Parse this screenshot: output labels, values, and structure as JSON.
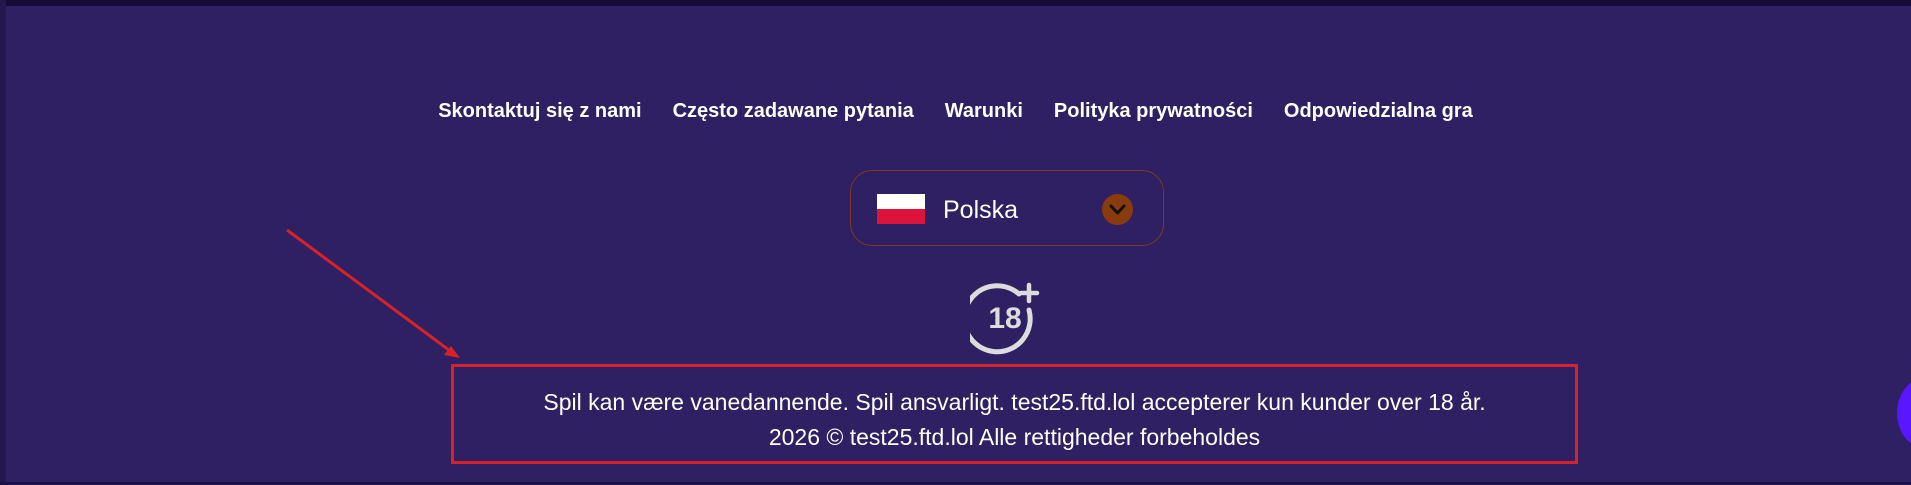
{
  "footer": {
    "nav_links": [
      {
        "label": "Skontaktuj się z nami"
      },
      {
        "label": "Często zadawane pytania"
      },
      {
        "label": "Warunki"
      },
      {
        "label": "Polityka prywatności"
      },
      {
        "label": "Odpowiedzialna gra"
      }
    ],
    "language_select": {
      "selected": "Polska",
      "flag_icon": "poland-flag-icon",
      "chevron_icon": "chevron-down-icon",
      "border_color": "#7c3a2a",
      "chevron_bg": "#8a3b0d"
    },
    "age_badge": {
      "icon": "18-plus-icon"
    },
    "disclaimer": {
      "line1": "Spil kan være vanedannende. Spil ansvarligt. test25.ftd.lol accepterer kun kunder over 18 år.",
      "line2": "2026 © test25.ftd.lol Alle rettigheder forbeholdes",
      "highlight_color": "#d8222a"
    }
  },
  "colors": {
    "background": "#2f1f63",
    "chat_button": "#5a16ff"
  }
}
